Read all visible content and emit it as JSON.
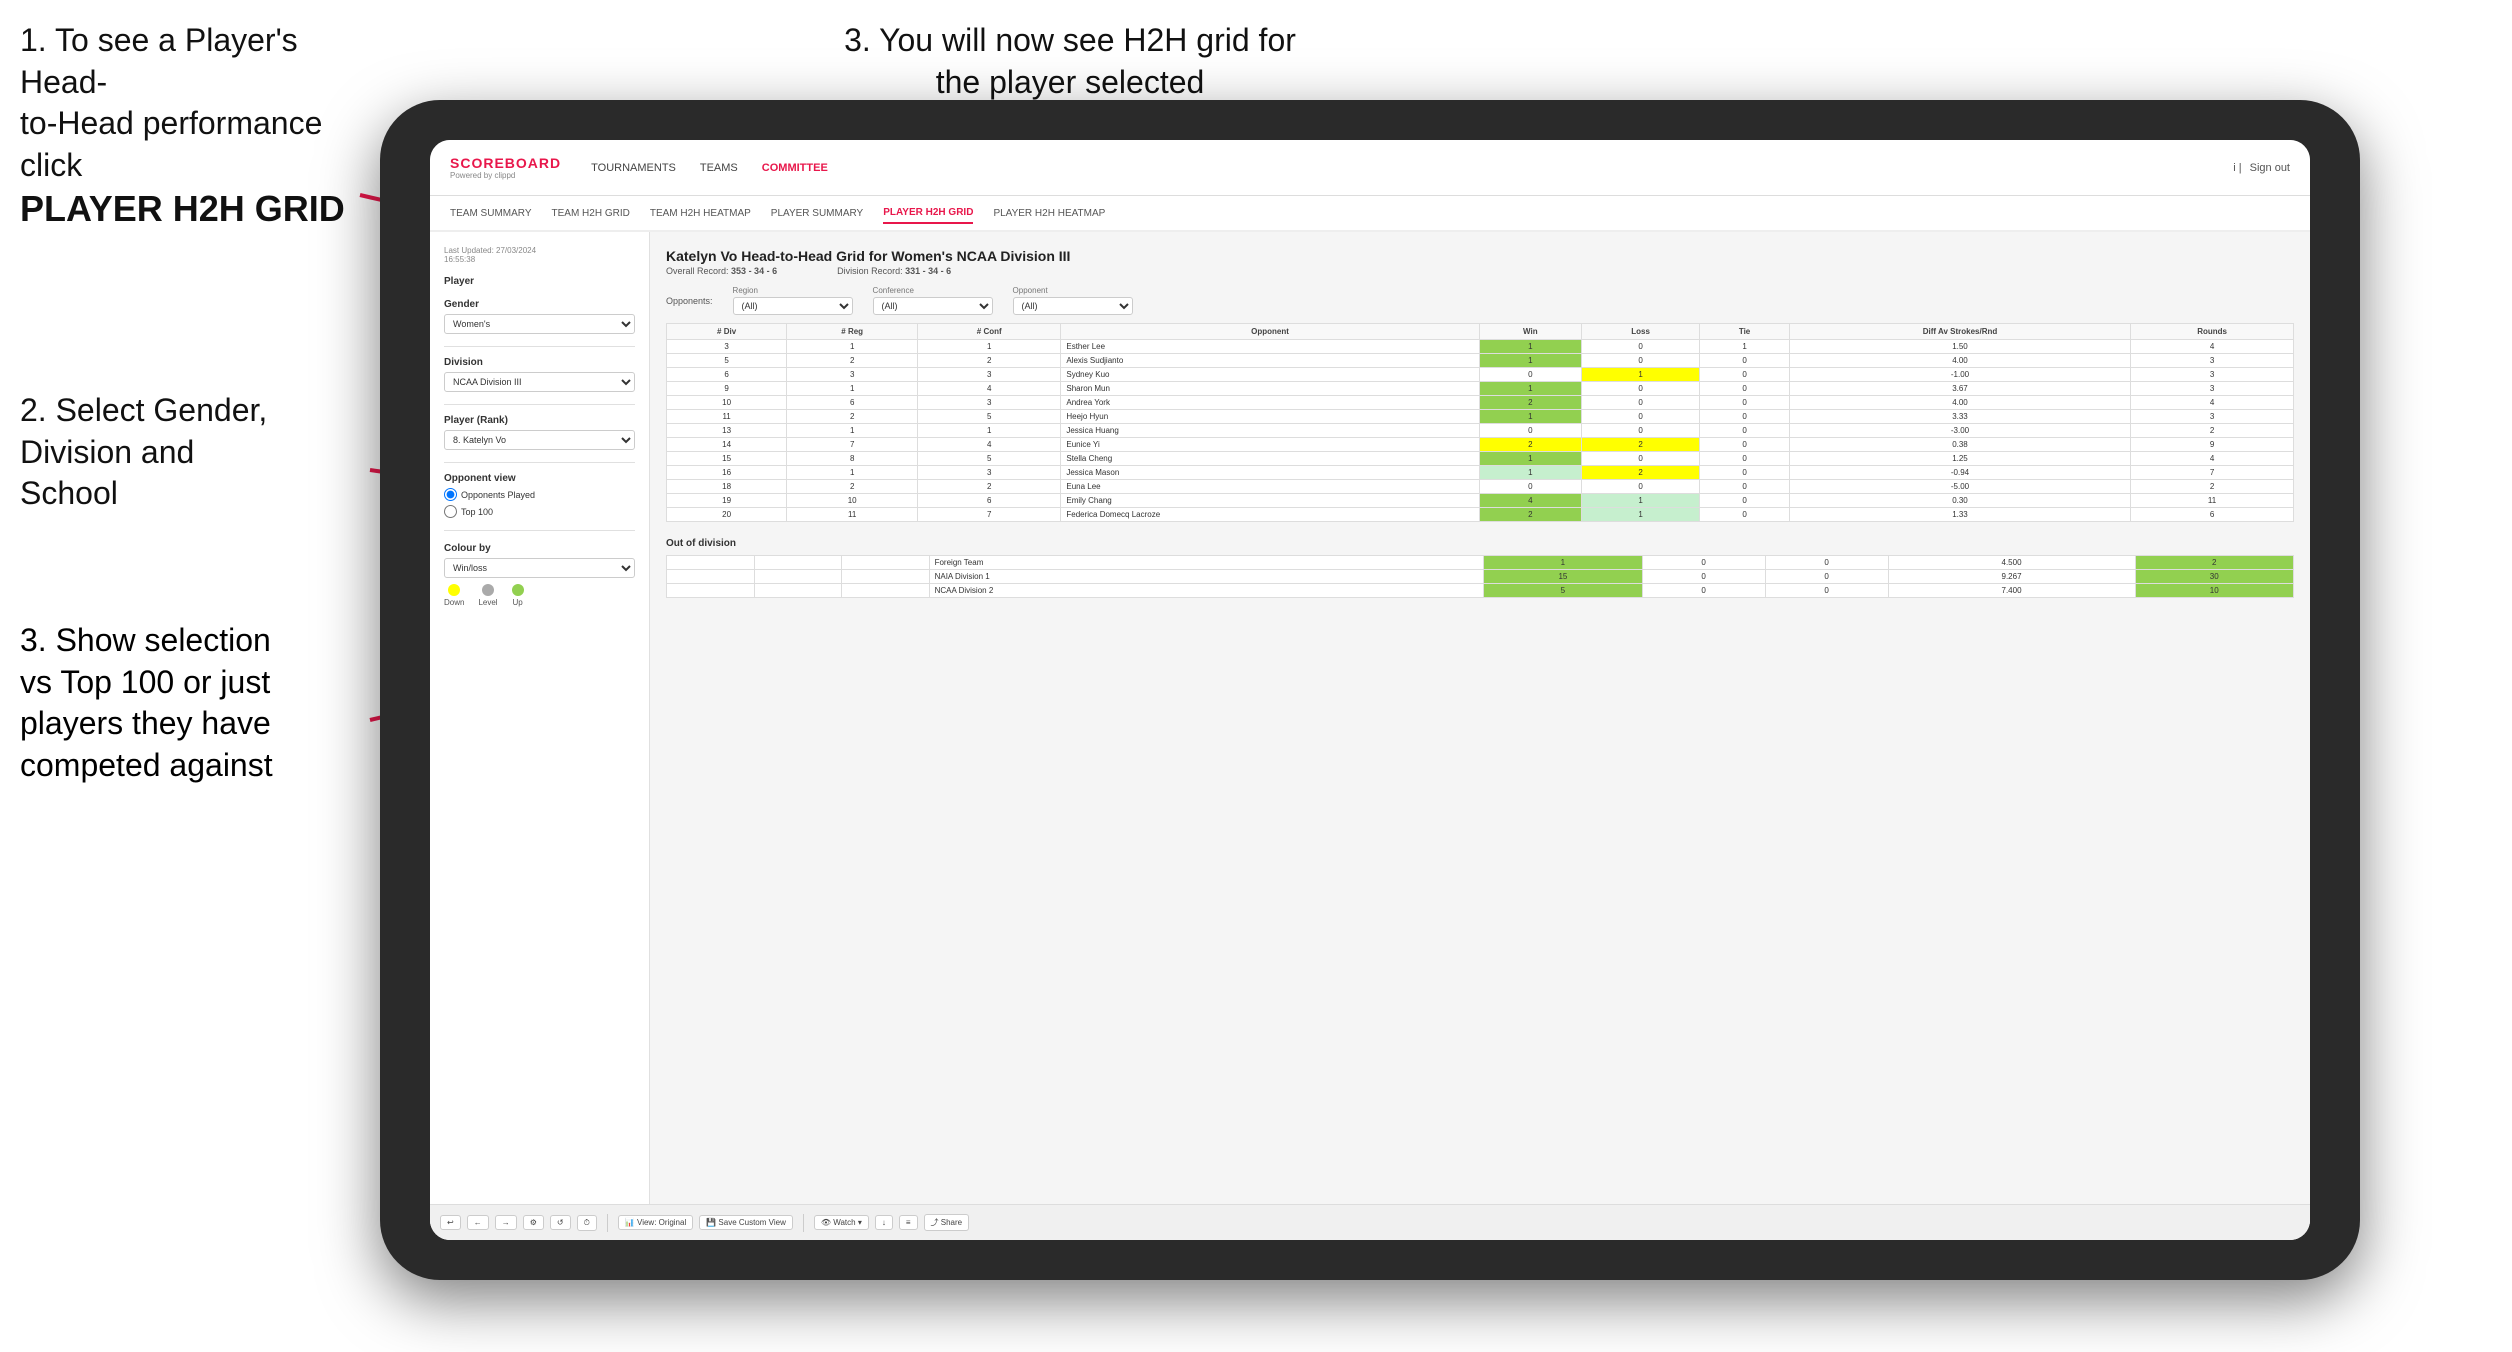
{
  "instructions": {
    "top_left_line1": "1. To see a Player's Head-",
    "top_left_line2": "to-Head performance click",
    "top_left_bold": "PLAYER H2H GRID",
    "top_right": "3. You will now see H2H grid for the player selected",
    "mid_left_line1": "2. Select Gender,",
    "mid_left_line2": "Division and",
    "mid_left_line3": "School",
    "bot_left_line1": "3. Show selection",
    "bot_left_line2": "vs Top 100 or just",
    "bot_left_line3": "players they have",
    "bot_left_line4": "competed against"
  },
  "nav": {
    "logo": "SCOREBOARD",
    "logo_sub": "Powered by clippd",
    "items": [
      "TOURNAMENTS",
      "TEAMS",
      "COMMITTEE"
    ],
    "active_item": "COMMITTEE",
    "right": "Sign out"
  },
  "subnav": {
    "items": [
      "TEAM SUMMARY",
      "TEAM H2H GRID",
      "TEAM H2H HEATMAP",
      "PLAYER SUMMARY",
      "PLAYER H2H GRID",
      "PLAYER H2H HEATMAP"
    ],
    "active": "PLAYER H2H GRID"
  },
  "sidebar": {
    "timestamp": "Last Updated: 27/03/2024",
    "timestamp2": "16:55:38",
    "player_label": "Player",
    "gender_label": "Gender",
    "gender_value": "Women's",
    "division_label": "Division",
    "division_value": "NCAA Division III",
    "player_rank_label": "Player (Rank)",
    "player_rank_value": "8. Katelyn Vo",
    "opponent_view_label": "Opponent view",
    "opponent_options": [
      "Opponents Played",
      "Top 100"
    ],
    "opponent_selected": "Opponents Played",
    "colour_by_label": "Colour by",
    "colour_by_value": "Win/loss",
    "legend": {
      "down_label": "Down",
      "level_label": "Level",
      "up_label": "Up"
    }
  },
  "main": {
    "title": "Katelyn Vo Head-to-Head Grid for Women's NCAA Division III",
    "overall_record_label": "Overall Record:",
    "overall_record": "353 - 34 - 6",
    "division_record_label": "Division Record:",
    "division_record": "331 - 34 - 6",
    "filters": {
      "opponents_label": "Opponents:",
      "region_label": "Region",
      "conference_label": "Conference",
      "opponent_label": "Opponent",
      "region_val": "(All)",
      "conference_val": "(All)",
      "opponent_val": "(All)"
    },
    "table_headers": [
      "# Div",
      "# Reg",
      "# Conf",
      "Opponent",
      "Win",
      "Loss",
      "Tie",
      "Diff Av Strokes/Rnd",
      "Rounds"
    ],
    "rows": [
      {
        "div": "3",
        "reg": "1",
        "conf": "1",
        "opponent": "Esther Lee",
        "win": "1",
        "loss": "0",
        "tie": "1",
        "diff": "1.50",
        "rounds": "4",
        "win_color": "green",
        "loss_color": "white",
        "tie_color": "white"
      },
      {
        "div": "5",
        "reg": "2",
        "conf": "2",
        "opponent": "Alexis Sudjianto",
        "win": "1",
        "loss": "0",
        "tie": "0",
        "diff": "4.00",
        "rounds": "3",
        "win_color": "green",
        "loss_color": "white",
        "tie_color": "white"
      },
      {
        "div": "6",
        "reg": "3",
        "conf": "3",
        "opponent": "Sydney Kuo",
        "win": "0",
        "loss": "1",
        "tie": "0",
        "diff": "-1.00",
        "rounds": "3",
        "win_color": "white",
        "loss_color": "yellow",
        "tie_color": "white"
      },
      {
        "div": "9",
        "reg": "1",
        "conf": "4",
        "opponent": "Sharon Mun",
        "win": "1",
        "loss": "0",
        "tie": "0",
        "diff": "3.67",
        "rounds": "3",
        "win_color": "green",
        "loss_color": "white",
        "tie_color": "white"
      },
      {
        "div": "10",
        "reg": "6",
        "conf": "3",
        "opponent": "Andrea York",
        "win": "2",
        "loss": "0",
        "tie": "0",
        "diff": "4.00",
        "rounds": "4",
        "win_color": "green",
        "loss_color": "white",
        "tie_color": "white"
      },
      {
        "div": "11",
        "reg": "2",
        "conf": "5",
        "opponent": "Heejo Hyun",
        "win": "1",
        "loss": "0",
        "tie": "0",
        "diff": "3.33",
        "rounds": "3",
        "win_color": "green",
        "loss_color": "white",
        "tie_color": "white"
      },
      {
        "div": "13",
        "reg": "1",
        "conf": "1",
        "opponent": "Jessica Huang",
        "win": "0",
        "loss": "0",
        "tie": "0",
        "diff": "-3.00",
        "rounds": "2",
        "win_color": "white",
        "loss_color": "white",
        "tie_color": "white"
      },
      {
        "div": "14",
        "reg": "7",
        "conf": "4",
        "opponent": "Eunice Yi",
        "win": "2",
        "loss": "2",
        "tie": "0",
        "diff": "0.38",
        "rounds": "9",
        "win_color": "yellow",
        "loss_color": "yellow",
        "tie_color": "white"
      },
      {
        "div": "15",
        "reg": "8",
        "conf": "5",
        "opponent": "Stella Cheng",
        "win": "1",
        "loss": "0",
        "tie": "0",
        "diff": "1.25",
        "rounds": "4",
        "win_color": "green",
        "loss_color": "white",
        "tie_color": "white"
      },
      {
        "div": "16",
        "reg": "1",
        "conf": "3",
        "opponent": "Jessica Mason",
        "win": "1",
        "loss": "2",
        "tie": "0",
        "diff": "-0.94",
        "rounds": "7",
        "win_color": "light-green",
        "loss_color": "yellow",
        "tie_color": "white"
      },
      {
        "div": "18",
        "reg": "2",
        "conf": "2",
        "opponent": "Euna Lee",
        "win": "0",
        "loss": "0",
        "tie": "0",
        "diff": "-5.00",
        "rounds": "2",
        "win_color": "white",
        "loss_color": "white",
        "tie_color": "white"
      },
      {
        "div": "19",
        "reg": "10",
        "conf": "6",
        "opponent": "Emily Chang",
        "win": "4",
        "loss": "1",
        "tie": "0",
        "diff": "0.30",
        "rounds": "11",
        "win_color": "green",
        "loss_color": "light-green",
        "tie_color": "white"
      },
      {
        "div": "20",
        "reg": "11",
        "conf": "7",
        "opponent": "Federica Domecq Lacroze",
        "win": "2",
        "loss": "1",
        "tie": "0",
        "diff": "1.33",
        "rounds": "6",
        "win_color": "green",
        "loss_color": "light-green",
        "tie_color": "white"
      }
    ],
    "out_of_division_title": "Out of division",
    "out_rows": [
      {
        "name": "Foreign Team",
        "win": "1",
        "loss": "0",
        "tie": "0",
        "diff": "4.500",
        "rounds": "2"
      },
      {
        "name": "NAIA Division 1",
        "win": "15",
        "loss": "0",
        "tie": "0",
        "diff": "9.267",
        "rounds": "30"
      },
      {
        "name": "NCAA Division 2",
        "win": "5",
        "loss": "0",
        "tie": "0",
        "diff": "7.400",
        "rounds": "10"
      }
    ]
  },
  "toolbar": {
    "buttons": [
      "↩",
      "←",
      "→",
      "⚙",
      "↺",
      "⏱",
      "View: Original",
      "Save Custom View",
      "Watch ▾",
      "↓",
      "≡",
      "Share"
    ]
  }
}
